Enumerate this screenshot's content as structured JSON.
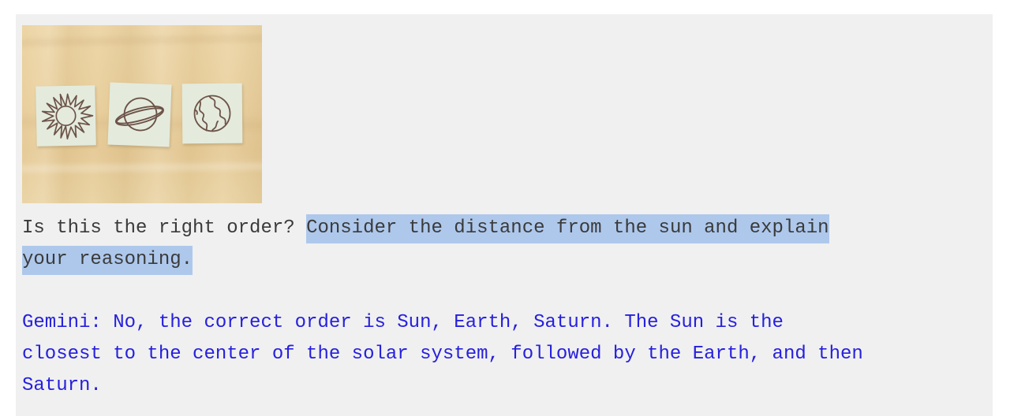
{
  "page": {
    "background_color": "#f0f0f0",
    "outer_color": "#ffffff"
  },
  "photo": {
    "alt_name": "three-sticky-notes-on-wooden-desk",
    "surface": "light wooden desk",
    "surface_color": "#e8cf9e",
    "note_color": "#e4ebdd",
    "ink_color": "#6d5348",
    "notes": [
      {
        "id": "note-sun",
        "drawing": "sun"
      },
      {
        "id": "note-saturn",
        "drawing": "saturn"
      },
      {
        "id": "note-earth",
        "drawing": "earth"
      }
    ]
  },
  "conversation": {
    "prompt": {
      "plain_prefix": "Is this the right order? ",
      "highlight_line1": "Consider the distance from the sun and explain",
      "highlight_line2": "your reasoning.",
      "highlight_color": "#aec8ec",
      "text_color": "#3a3a3a"
    },
    "response": {
      "speaker_label": "Gemini:",
      "line1": "Gemini: No, the correct order is Sun, Earth, Saturn. The Sun is the",
      "line2": "closest to the center of the solar system, followed by the Earth, and then",
      "line3": "Saturn.",
      "text_color": "#2620dd"
    }
  }
}
